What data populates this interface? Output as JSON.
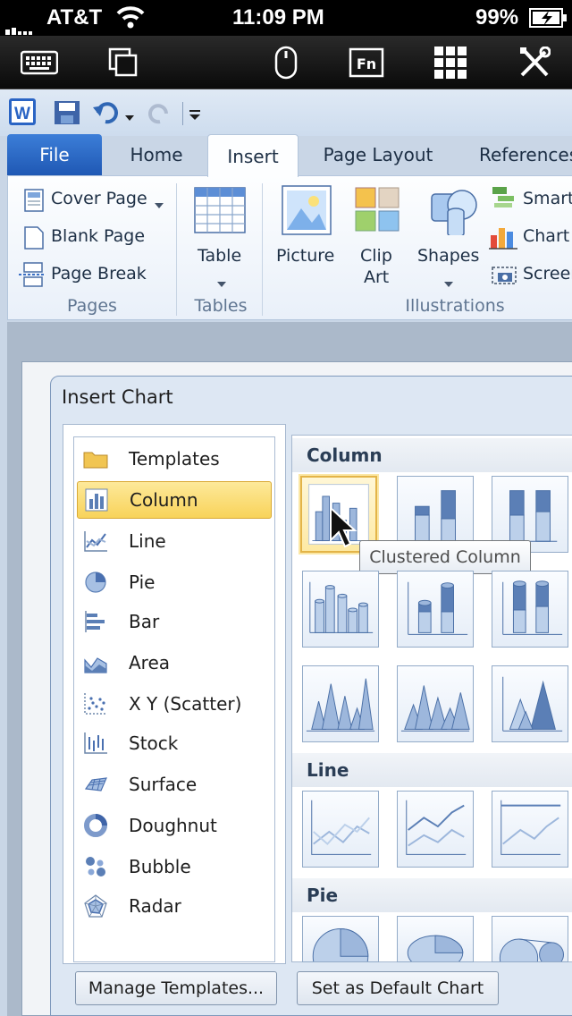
{
  "status_bar": {
    "carrier": "AT&T",
    "time": "11:09 PM",
    "battery": "99%"
  },
  "remote_toolbar": {
    "fn_label": "Fn"
  },
  "ribbon": {
    "tabs": [
      "File",
      "Home",
      "Insert",
      "Page Layout",
      "References"
    ],
    "active_tab": "Insert",
    "pages": {
      "cover_page": "Cover Page",
      "blank_page": "Blank Page",
      "page_break": "Page Break",
      "group": "Pages"
    },
    "tables": {
      "table": "Table",
      "group": "Tables"
    },
    "illustrations": {
      "picture": "Picture",
      "clip_art_1": "Clip",
      "clip_art_2": "Art",
      "shapes": "Shapes",
      "smartart": "Smart",
      "chart": "Chart",
      "screenshot": "Screen",
      "group": "Illustrations"
    }
  },
  "dialog": {
    "title": "Insert Chart",
    "categories": [
      "Templates",
      "Column",
      "Line",
      "Pie",
      "Bar",
      "Area",
      "X Y (Scatter)",
      "Stock",
      "Surface",
      "Doughnut",
      "Bubble",
      "Radar"
    ],
    "selected_category": "Column",
    "sections": {
      "column": "Column",
      "line": "Line",
      "pie": "Pie"
    },
    "tooltip": "Clustered Column",
    "buttons": {
      "manage": "Manage Templates...",
      "set_default": "Set as Default Chart"
    }
  },
  "colors": {
    "file_tab": "#2a64c4",
    "selection": "#f8d35a",
    "ribbon_bg": "#e9f0f9"
  }
}
